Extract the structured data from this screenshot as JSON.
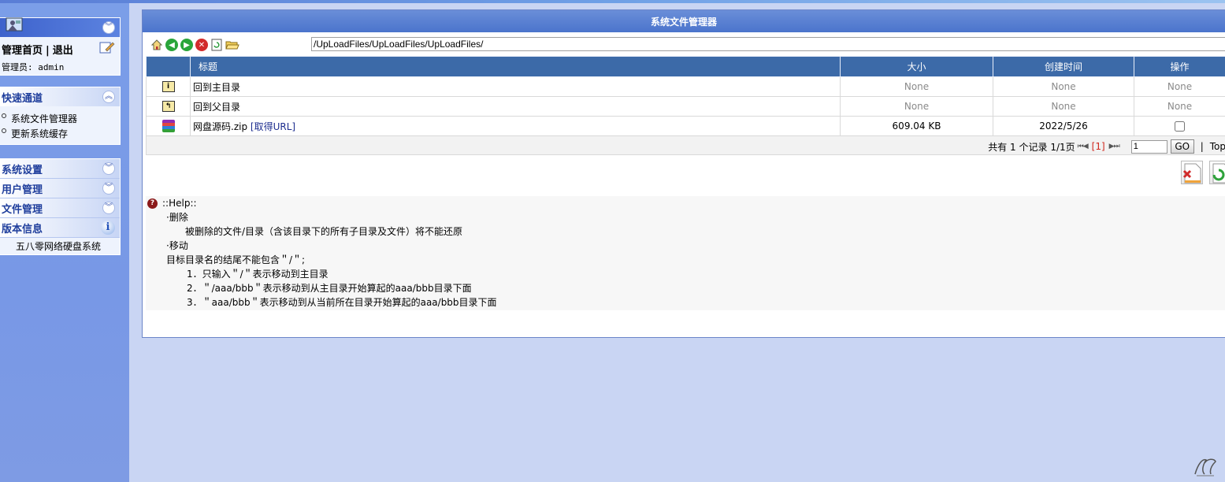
{
  "sidebar": {
    "nav_links": {
      "home": "管理首页",
      "separator": "|",
      "logout": "退出"
    },
    "admin_text": "管理员: admin",
    "quick": {
      "title": "快速通道",
      "items": [
        "系统文件管理器",
        "更新系统缓存"
      ]
    },
    "menus": [
      "系统设置",
      "用户管理",
      "文件管理"
    ],
    "version": {
      "title": "版本信息",
      "product": "五八零网络硬盘系统"
    }
  },
  "window": {
    "title": "系统文件管理器",
    "path": "/UpLoadFiles/UpLoadFiles/UpLoadFiles/"
  },
  "table": {
    "headers": [
      "标题",
      "大小",
      "创建时间",
      "操作"
    ],
    "rows": [
      {
        "name": "回到主目录",
        "size": "None",
        "created": "None",
        "op": "None"
      },
      {
        "name": "回到父目录",
        "size": "None",
        "created": "None",
        "op": "None"
      },
      {
        "name": "网盘源码.zip",
        "link": "[取得URL]",
        "size": "609.04 KB",
        "created": "2022/5/26"
      }
    ]
  },
  "pager": {
    "summary": "共有 1 个记录 1/1页",
    "first_prev": "⏮◀",
    "current": "[1]",
    "next_last": "▶⏭",
    "page_value": "1",
    "go": "GO",
    "separator": "|",
    "top": "Top"
  },
  "help": {
    "heading": "::Help::",
    "lines": [
      "·删除",
      "被删除的文件/目录（含该目录下的所有子目录及文件）将不能还原",
      "·移动",
      "目标目录名的结尾不能包含＂/＂;",
      "1．只输入＂/＂表示移动到主目录",
      "2．＂/aaa/bbb＂表示移动到从主目录开始算起的aaa/bbb目录下面",
      "3．＂aaa/bbb＂表示移动到从当前所在目录开始算起的aaa/bbb目录下面"
    ]
  }
}
